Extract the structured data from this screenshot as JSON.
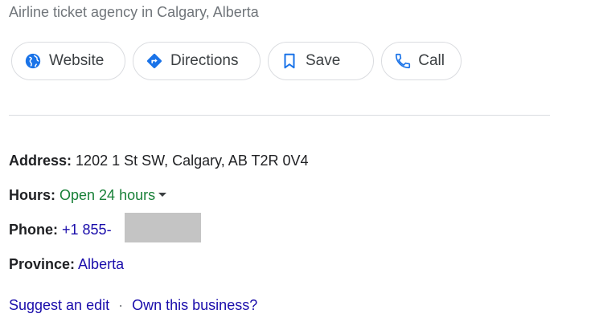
{
  "subtitle": "Airline ticket agency in Calgary, Alberta",
  "actions": [
    {
      "label": "Website",
      "icon": "globe-icon"
    },
    {
      "label": "Directions",
      "icon": "directions-icon"
    },
    {
      "label": "Save",
      "icon": "bookmark-icon"
    },
    {
      "label": "Call",
      "icon": "phone-icon"
    }
  ],
  "details": {
    "address": {
      "label": "Address:",
      "value": "1202 1 St SW, Calgary, AB T2R 0V4"
    },
    "hours": {
      "label": "Hours:",
      "value": "Open 24 hours"
    },
    "phone": {
      "label": "Phone:",
      "value": "+1 855-"
    },
    "province": {
      "label": "Province:",
      "value": "Alberta"
    }
  },
  "footer": {
    "suggest_edit": "Suggest an edit",
    "separator": "·",
    "own_business": "Own this business?"
  },
  "colors": {
    "accent_blue": "#1a73e8",
    "link": "#1a0dab",
    "open_green": "#188038"
  }
}
